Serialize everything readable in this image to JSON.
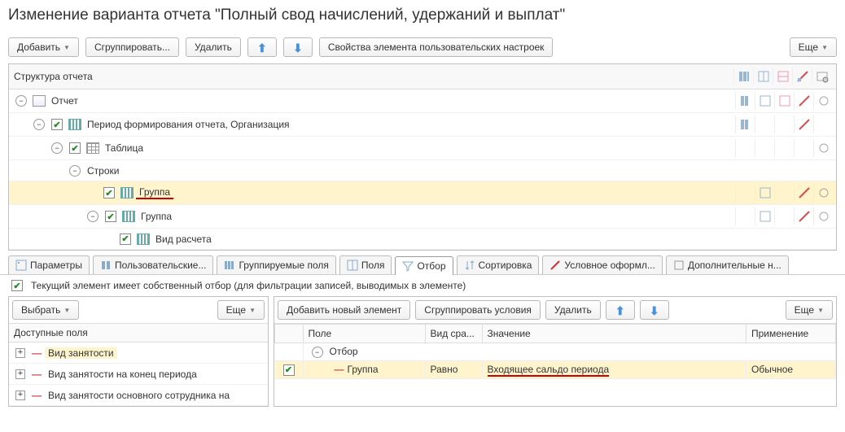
{
  "title": "Изменение варианта отчета \"Полный свод начислений, удержаний и выплат\"",
  "toolbar": {
    "add": "Добавить",
    "group": "Сгруппировать...",
    "delete": "Удалить",
    "props": "Свойства элемента пользовательских настроек",
    "more": "Еще"
  },
  "structure": {
    "header": "Структура отчета",
    "nodes": {
      "report": "Отчет",
      "period": "Период формирования отчета, Организация",
      "table": "Таблица",
      "rows": "Строки",
      "group1": "Группа",
      "group2": "Группа",
      "calc": "Вид расчета"
    }
  },
  "tabs": {
    "params": "Параметры",
    "user": "Пользовательские...",
    "grouped": "Группируемые поля",
    "fields": "Поля",
    "filter": "Отбор",
    "sort": "Сортировка",
    "cond": "Условное оформл...",
    "extra": "Дополнительные н..."
  },
  "filter_check": "Текущий элемент имеет собственный отбор (для фильтрации записей, выводимых в элементе)",
  "left": {
    "select": "Выбрать",
    "more": "Еще",
    "header": "Доступные поля",
    "items": {
      "i1": "Вид занятости",
      "i2": "Вид занятости на конец периода",
      "i3": "Вид занятости основного сотрудника на"
    }
  },
  "right": {
    "add_new": "Добавить новый элемент",
    "group_cond": "Сгруппировать условия",
    "delete": "Удалить",
    "more": "Еще",
    "cols": {
      "field": "Поле",
      "cmp": "Вид сра...",
      "value": "Значение",
      "apply": "Применение"
    },
    "rows": {
      "otbor": "Отбор",
      "r1": {
        "field": "Группа",
        "cmp": "Равно",
        "value": "Входящее сальдо периода",
        "apply": "Обычное"
      }
    }
  }
}
